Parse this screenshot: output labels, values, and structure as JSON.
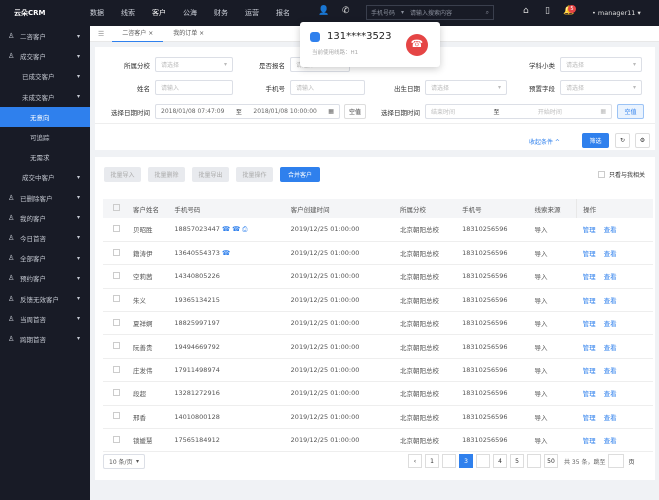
{
  "top": {
    "logo": "云朵CRM",
    "nav": [
      "数据",
      "线索",
      "客户",
      "公海",
      "财务",
      "运营",
      "报名"
    ],
    "active_nav": "客户",
    "search_type": "手机号码",
    "search_placeholder": "请输入搜索内容",
    "badge": "5",
    "user": "manager11"
  },
  "call": {
    "number": "131****3523",
    "line": "当前使用线路：H1",
    "hangup_color": "#e54545"
  },
  "sidebar": [
    {
      "label": "二咨客户",
      "lvl": 0
    },
    {
      "label": "成交客户",
      "lvl": 0
    },
    {
      "label": "已成交客户",
      "lvl": 1
    },
    {
      "label": "未成交客户",
      "lvl": 1
    },
    {
      "label": "无意向",
      "lvl": 2,
      "active": true
    },
    {
      "label": "可追踪",
      "lvl": 2
    },
    {
      "label": "无需求",
      "lvl": 2
    },
    {
      "label": "成交中客户",
      "lvl": 1
    },
    {
      "label": "已删除客户",
      "lvl": 0
    },
    {
      "label": "我的客户",
      "lvl": 0
    },
    {
      "label": "今日首咨",
      "lvl": 0
    },
    {
      "label": "全部客户",
      "lvl": 0
    },
    {
      "label": "预约客户",
      "lvl": 0
    },
    {
      "label": "反馈无效客户",
      "lvl": 0
    },
    {
      "label": "当周首咨",
      "lvl": 0
    },
    {
      "label": "跨期首咨",
      "lvl": 0
    }
  ],
  "tabs": [
    "二咨客户",
    "我的订单"
  ],
  "filters": {
    "branch": "所属分校",
    "enrolled": "是否报名",
    "subject": "学科小类",
    "name": "姓名",
    "phone": "手机号",
    "birth": "出生日期",
    "preset": "预置字段",
    "datetime": "选择日期时间",
    "select_ph": "请选择",
    "input_ph": "请输入",
    "start1": "2018/01/08 07:47:09",
    "to": "至",
    "end1": "2018/01/08 10:00:00",
    "empty": "空值",
    "start_ph": "结束时间",
    "end_ph": "开始时间",
    "collapse": "收起条件 ^",
    "filter": "筛选"
  },
  "actions": [
    "批量导入",
    "批量删除",
    "批量导出",
    "批量操作"
  ],
  "merge": "合并客户",
  "only_mine": "只看与我相关",
  "columns": [
    "客户姓名",
    "手机号码",
    "客户创建时间",
    "所属分校",
    "手机号",
    "线索来源",
    "操作"
  ],
  "rows": [
    [
      "贝昭胜",
      "18857023447",
      "2019/12/25  01:00:00",
      "北京朝阳总校",
      "18310256596",
      "导入"
    ],
    [
      "籍涛伊",
      "13640554373",
      "2019/12/25  01:00:00",
      "北京朝阳总校",
      "18310256596",
      "导入"
    ],
    [
      "空莉茜",
      "14340805226",
      "2019/12/25  01:00:00",
      "北京朝阳总校",
      "18310256596",
      "导入"
    ],
    [
      "朱义",
      "19365134215",
      "2019/12/25  01:00:00",
      "北京朝阳总校",
      "18310256596",
      "导入"
    ],
    [
      "夏祥婀",
      "18825997197",
      "2019/12/25  01:00:00",
      "北京朝阳总校",
      "18310256596",
      "导入"
    ],
    [
      "阮善贵",
      "19494669792",
      "2019/12/25  01:00:00",
      "北京朝阳总校",
      "18310256596",
      "导入"
    ],
    [
      "庄发伟",
      "17911498974",
      "2019/12/25  01:00:00",
      "北京朝阳总校",
      "18310256596",
      "导入"
    ],
    [
      "段超",
      "13281272916",
      "2019/12/25  01:00:00",
      "北京朝阳总校",
      "18310256596",
      "导入"
    ],
    [
      "邢香",
      "14010800128",
      "2019/12/25  01:00:00",
      "北京朝阳总校",
      "18310256596",
      "导入"
    ],
    [
      "锁媛慧",
      "17565184912",
      "2019/12/25  01:00:00",
      "北京朝阳总校",
      "18310256596",
      "导入"
    ]
  ],
  "ops": [
    "管理",
    "查看"
  ],
  "pager": {
    "size": "10 条/页",
    "pages": [
      "1",
      "",
      "3",
      "",
      "4",
      "5",
      "",
      "50"
    ],
    "current": "3",
    "total": "共 35 条，跳至",
    "unit": "页"
  }
}
